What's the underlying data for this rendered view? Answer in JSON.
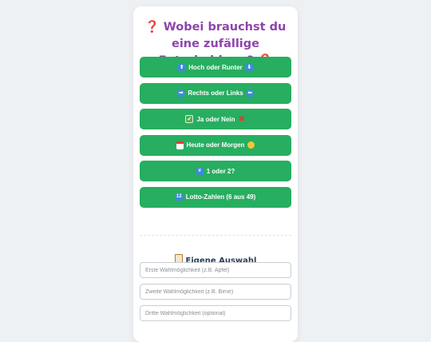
{
  "title": {
    "icon": "red-question-mark-icon",
    "text": "Wobei brauchst du eine zufällige Entscheidung?"
  },
  "buttons": [
    {
      "label": "Hoch oder Runter",
      "icons": [
        "up-arrow-icon",
        "down-arrow-icon"
      ]
    },
    {
      "label": "Rechts oder Links",
      "icons": [
        "right-arrow-icon",
        "left-arrow-icon"
      ]
    },
    {
      "label": "Ja oder Nein",
      "icons": [
        "check-mark-icon",
        "cross-mark-icon"
      ]
    },
    {
      "label": "Heute oder Morgen",
      "icons": [
        "calendar-icon",
        "sun-icon"
      ]
    },
    {
      "label": "1 oder 2?",
      "icons": [
        "number-icon"
      ]
    },
    {
      "label": "Lotto-Zahlen (6 aus 49)",
      "icons": [
        "numbers-icon"
      ]
    }
  ],
  "custom": {
    "title": "Eigene Auswahl",
    "icon": "clipboard-icon",
    "fields": [
      {
        "placeholder": "Erste Wahlmöglichkeit (z.B. Apfel)"
      },
      {
        "placeholder": "Zweite Wahlmöglichkeit (z.B. Birne)"
      },
      {
        "placeholder": "Dritte Wahlmöglichkeit (optional)"
      }
    ]
  },
  "colors": {
    "title": "#8e44ad",
    "button": "#27ae60",
    "background": "#eef1f4"
  }
}
